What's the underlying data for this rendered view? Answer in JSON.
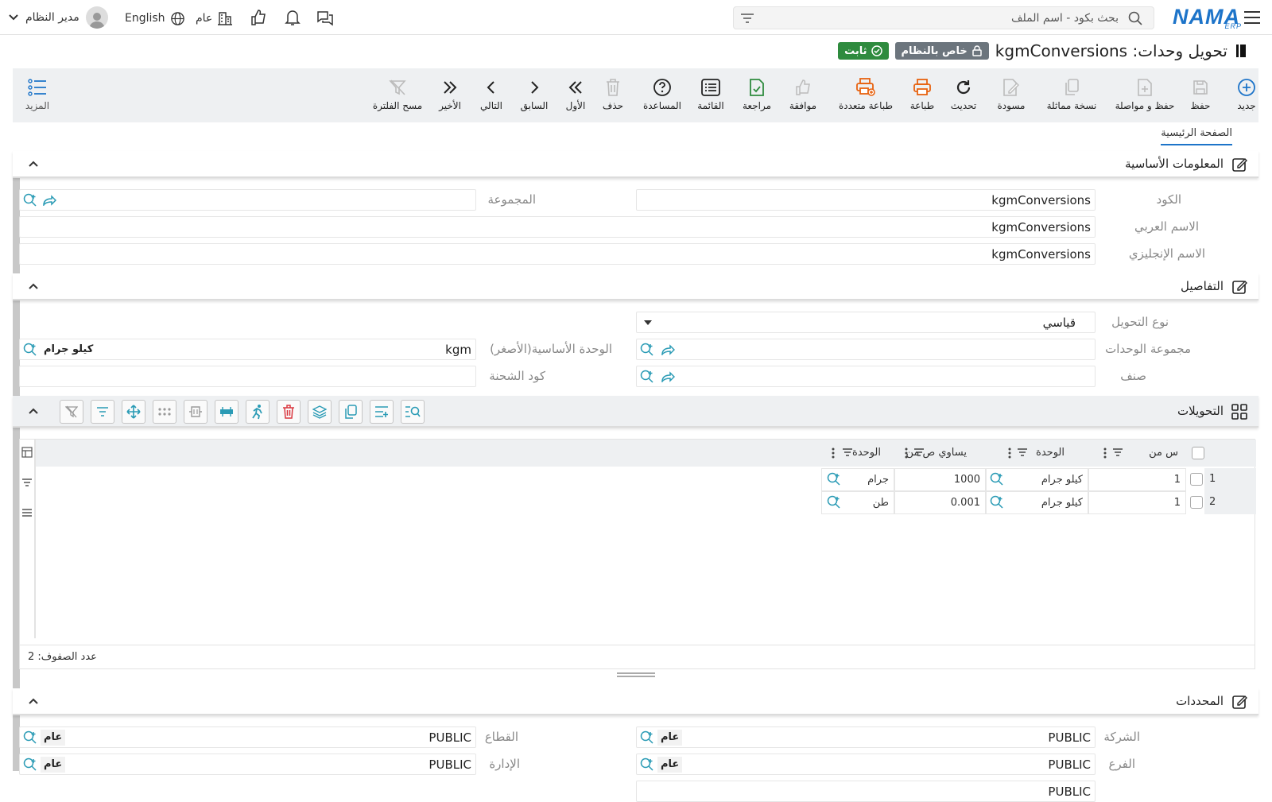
{
  "topbar": {
    "logo": "NAMA",
    "logo_sub": "ERP",
    "search_placeholder": "بحث بكود - اسم الملف",
    "user_name": "مدير النظام",
    "language": "English",
    "scope": "عام"
  },
  "title": {
    "text": "تحويل وحدات: kgmConversions",
    "system_badge": "خاص بالنظام",
    "status_badge": "ثابت"
  },
  "toolbar": {
    "new": "جديد",
    "save": "حفظ",
    "save_continue": "حفظ و مواصلة",
    "duplicate": "نسخة مماثلة",
    "draft": "مسودة",
    "refresh": "تحديث",
    "print": "طباعة",
    "multi_print": "طباعة متعددة",
    "approve": "موافقة",
    "review": "مراجعة",
    "list": "القائمة",
    "help": "المساعدة",
    "delete": "حذف",
    "first": "الأول",
    "previous": "السابق",
    "next": "التالي",
    "last": "الأخير",
    "clear_filter": "مسح الفلترة",
    "more": "المزيد"
  },
  "tabs": {
    "main": "الصفحة الرئيسية"
  },
  "sections": {
    "basic": "المعلومات الأساسية",
    "details": "التفاصيل",
    "conversions": "التحويلات",
    "dimensions": "المحددات"
  },
  "basic": {
    "code_label": "الكود",
    "code_value": "kgmConversions",
    "group_label": "المجموعة",
    "arabic_name_label": "الاسم العربي",
    "arabic_name_value": "kgmConversions",
    "english_name_label": "الاسم الإنجليزي",
    "english_name_value": "kgmConversions"
  },
  "details": {
    "conversion_type_label": "نوع التحويل",
    "conversion_type_value": "قياسي",
    "unit_group_label": "مجموعة الوحدات",
    "base_unit_label": "الوحدة الأساسية(الأصغر)",
    "base_unit_code": "kgm",
    "base_unit_name": "كيلو جرام",
    "item_label": "صنف",
    "batch_code_label": "كود الشحنة"
  },
  "grid": {
    "columns": [
      "س من",
      "الوحدة",
      "يساوي ص من",
      "الوحدة"
    ],
    "rows": [
      {
        "num": "1",
        "x_from": "1",
        "unit": "كيلو جرام",
        "equals": "1000",
        "to_unit": "جرام"
      },
      {
        "num": "2",
        "x_from": "1",
        "unit": "كيلو جرام",
        "equals": "0.001",
        "to_unit": "طن"
      }
    ],
    "row_count": "عدد الصفوف: 2"
  },
  "dimensions": {
    "company_label": "الشركة",
    "company_value": "PUBLIC",
    "company_chip": "عام",
    "sector_label": "القطاع",
    "sector_value": "PUBLIC",
    "sector_chip": "عام",
    "branch_label": "الفرع",
    "branch_value": "PUBLIC",
    "branch_chip": "عام",
    "department_label": "الإدارة",
    "department_value": "PUBLIC",
    "department_chip": "عام",
    "analytic_set_value": "PUBLIC"
  },
  "colors": {
    "brand": "#1d74c9",
    "accent_teal": "#2a9bb5",
    "status_green": "#2e8b3e",
    "badge_grey": "#6c757d",
    "print_orange": "#e8620f",
    "delete_red": "#d9363e",
    "toolbar_bg": "#eef0f2"
  }
}
